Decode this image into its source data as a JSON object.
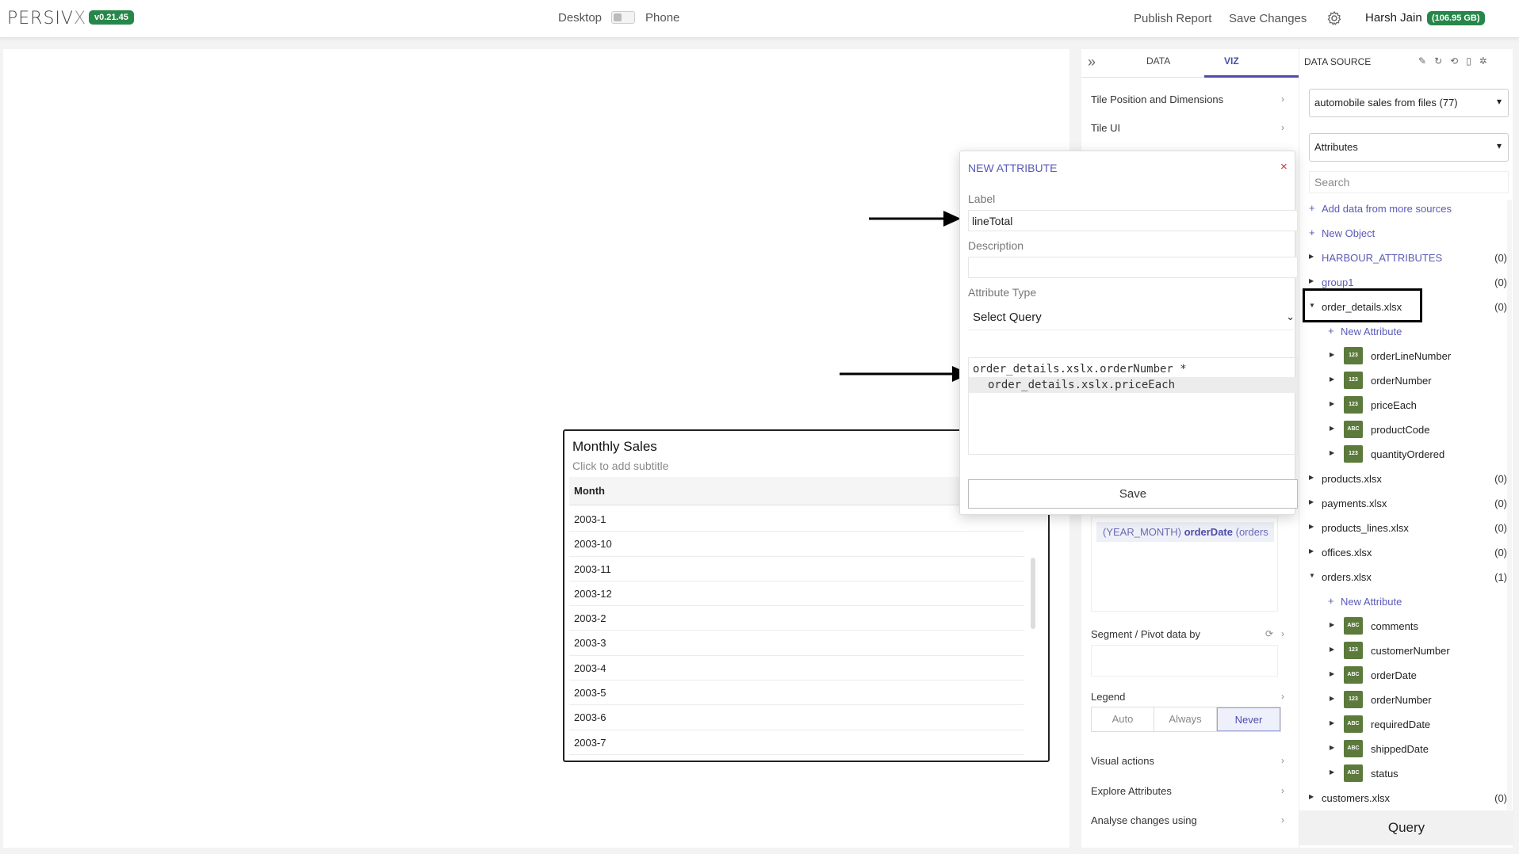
{
  "header": {
    "logo_main": "PERSIV",
    "logo_x": "X",
    "version": "v0.21.45",
    "device_desktop": "Desktop",
    "device_phone": "Phone",
    "publish_label": "Publish Report",
    "save_label": "Save Changes",
    "user_name": "Harsh Jain",
    "storage": "(106.95 GB)"
  },
  "tile": {
    "title": "Monthly Sales",
    "subtitle": "Click to add subtitle",
    "column_header": "Month",
    "rows": [
      "2003-1",
      "2003-10",
      "2003-11",
      "2003-12",
      "2003-2",
      "2003-3",
      "2003-4",
      "2003-5",
      "2003-6",
      "2003-7"
    ]
  },
  "viz_panel": {
    "tabs": {
      "data": "DATA",
      "viz": "VIZ"
    },
    "tile_position": "Tile Position and Dimensions",
    "tile_ui": "Tile UI",
    "pill_prefix": "(YEAR_MONTH)",
    "pill_field": "orderDate",
    "pill_suffix": "(orders",
    "segment_label": "Segment / Pivot data by",
    "legend_label": "Legend",
    "legend_options": [
      "Auto",
      "Always",
      "Never"
    ],
    "visual_actions": "Visual actions",
    "explore_attributes": "Explore Attributes",
    "analyse_changes": "Analyse changes using"
  },
  "data_source": {
    "title": "DATA SOURCE",
    "source_select": "automobile sales from files (77)",
    "type_select": "Attributes",
    "search_placeholder": "Search",
    "add_data": "Add data from more sources",
    "new_object": "New Object",
    "new_attribute": "New Attribute",
    "groups": [
      {
        "name": "HARBOUR_ATTRIBUTES",
        "count": "(0)"
      },
      {
        "name": "group1",
        "count": "(0)"
      },
      {
        "name": "order_details.xlsx",
        "count": "(0)"
      },
      {
        "name": "products.xlsx",
        "count": "(0)"
      },
      {
        "name": "payments.xlsx",
        "count": "(0)"
      },
      {
        "name": "products_lines.xlsx",
        "count": "(0)"
      },
      {
        "name": "offices.xlsx",
        "count": "(0)"
      },
      {
        "name": "orders.xlsx",
        "count": "(1)"
      },
      {
        "name": "customers.xlsx",
        "count": "(0)"
      }
    ],
    "order_details_fields": [
      {
        "badge": "123",
        "name": "orderLineNumber"
      },
      {
        "badge": "123",
        "name": "orderNumber"
      },
      {
        "badge": "123",
        "name": "priceEach"
      },
      {
        "badge": "ABC",
        "name": "productCode"
      },
      {
        "badge": "123",
        "name": "quantityOrdered"
      }
    ],
    "orders_fields": [
      {
        "badge": "ABC",
        "name": "comments"
      },
      {
        "badge": "123",
        "name": "customerNumber"
      },
      {
        "badge": "ABC",
        "name": "orderDate"
      },
      {
        "badge": "123",
        "name": "orderNumber"
      },
      {
        "badge": "ABC",
        "name": "requiredDate"
      },
      {
        "badge": "ABC",
        "name": "shippedDate"
      },
      {
        "badge": "ABC",
        "name": "status"
      }
    ],
    "query_button": "Query"
  },
  "modal": {
    "title": "NEW ATTRIBUTE",
    "close": "×",
    "label_caption": "Label",
    "label_value": "lineTotal",
    "description_caption": "Description",
    "description_value": "",
    "type_caption": "Attribute Type",
    "type_value": "Select Query",
    "query_line1": "order_details.xslx.orderNumber *",
    "query_line2": "order_details.xslx.priceEach",
    "save_label": "Save"
  }
}
